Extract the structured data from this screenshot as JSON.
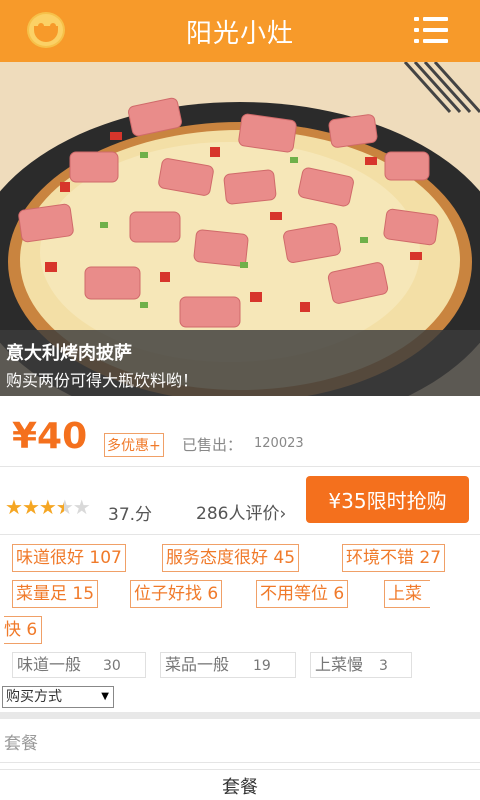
{
  "header": {
    "title": "阳光小灶"
  },
  "hero": {
    "title": "意大利烤肉披萨",
    "subtitle": "购买两份可得大瓶饮料哟！"
  },
  "product": {
    "price": "¥40",
    "discount_tag": "多优惠+",
    "sold_label": "已售出：",
    "sold_count": "120023"
  },
  "rating": {
    "stars": 3.5,
    "score": "37.分",
    "review_count": "286人评价›",
    "accent_color": "#f5a623"
  },
  "buy_button": {
    "label": "¥35限时抢购"
  },
  "tags": {
    "positive": [
      "味道很好 107",
      "服务态度很好 45",
      "环境不错 27",
      "菜量足 15",
      "位子好找 6",
      "不用等位 6"
    ],
    "wrap_first": "上菜",
    "wrap_second": "快 6",
    "neutral": [
      {
        "label": "味道一般",
        "count": "30"
      },
      {
        "label": "菜品一般",
        "count": "19"
      },
      {
        "label": "上菜慢",
        "count": "3"
      }
    ]
  },
  "purchase": {
    "select_value": "购买方式",
    "option_label": "套餐",
    "option_button": "套餐"
  },
  "colors": {
    "brand": "#f79a2a",
    "accent": "#f4701d"
  }
}
